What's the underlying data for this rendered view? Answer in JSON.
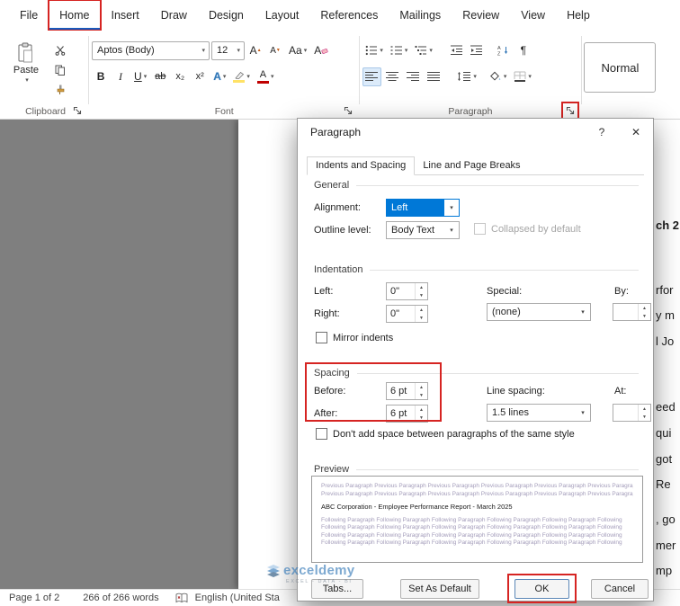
{
  "icons": {
    "dropdown": "▾",
    "spinner_up": "▲",
    "spinner_down": "▼",
    "close": "✕",
    "help": "?",
    "pilcrow": "¶",
    "bold": "B",
    "italic": "I",
    "underline": "U",
    "strikethrough": "ab",
    "subscript": "x₂",
    "superscript": "x²",
    "grow_font": "A",
    "shrink_font": "A",
    "change_case": "Aa",
    "clear_format": "A",
    "text_effects": "A",
    "font_color": "A"
  },
  "menu": {
    "items": [
      "File",
      "Home",
      "Insert",
      "Draw",
      "Design",
      "Layout",
      "References",
      "Mailings",
      "Review",
      "View",
      "Help"
    ]
  },
  "ribbon": {
    "clipboard_label": "Clipboard",
    "paste_label": "Paste",
    "font_label": "Font",
    "font_name": "Aptos (Body)",
    "font_size": "12",
    "paragraph_label": "Paragraph",
    "style_normal": "Normal"
  },
  "dialog": {
    "title": "Paragraph",
    "tab_indents": "Indents and Spacing",
    "tab_line": "Line and Page Breaks",
    "general": {
      "heading": "General",
      "alignment_label": "Alignment:",
      "alignment_value": "Left",
      "outline_label": "Outline level:",
      "outline_value": "Body Text",
      "collapsed_label": "Collapsed by default"
    },
    "indentation": {
      "heading": "Indentation",
      "left_label": "Left:",
      "left_value": "0\"",
      "right_label": "Right:",
      "right_value": "0\"",
      "special_label": "Special:",
      "special_value": "(none)",
      "by_label": "By:",
      "by_value": "",
      "mirror_label": "Mirror indents"
    },
    "spacing": {
      "heading": "Spacing",
      "before_label": "Before:",
      "before_value": "6 pt",
      "after_label": "After:",
      "after_value": "6 pt",
      "line_spacing_label": "Line spacing:",
      "line_spacing_value": "1.5 lines",
      "at_label": "At:",
      "at_value": "",
      "dont_add_label": "Don't add space between paragraphs of the same style"
    },
    "preview": {
      "heading": "Preview",
      "previous": [
        "Previous Paragraph Previous Paragraph Previous Paragraph Previous Paragraph Previous Paragraph Previous Paragraph",
        "Previous Paragraph Previous Paragraph Previous Paragraph Previous Paragraph Previous Paragraph Previous Paragraph"
      ],
      "sample": "ABC Corporation - Employee Performance Report - March 2025",
      "following": [
        "Following Paragraph Following Paragraph Following Paragraph Following Paragraph Following Paragraph Following",
        "Following Paragraph Following Paragraph Following Paragraph Following Paragraph Following Paragraph Following",
        "Following Paragraph Following Paragraph Following Paragraph Following Paragraph Following Paragraph Following",
        "Following Paragraph Following Paragraph Following Paragraph Following Paragraph Following Paragraph Following"
      ]
    },
    "buttons": {
      "tabs": "Tabs...",
      "set_default": "Set As Default",
      "ok": "OK",
      "cancel": "Cancel"
    }
  },
  "status": {
    "page": "Page 1 of 2",
    "words": "266 of 266 words",
    "language": "English (United Sta"
  },
  "document": {
    "fragments": [
      "ch 2",
      "rfor",
      "y m",
      "l Jo",
      "eed",
      "qui",
      "got",
      "Re",
      ", go",
      "mer",
      "mp"
    ]
  },
  "watermark": {
    "brand": "exceldemy",
    "tagline": "EXCEL - DATA - BI"
  },
  "colors": {
    "accent_blue": "#185abd",
    "selection_blue": "#0078d7",
    "annotation_red": "#d62422"
  }
}
